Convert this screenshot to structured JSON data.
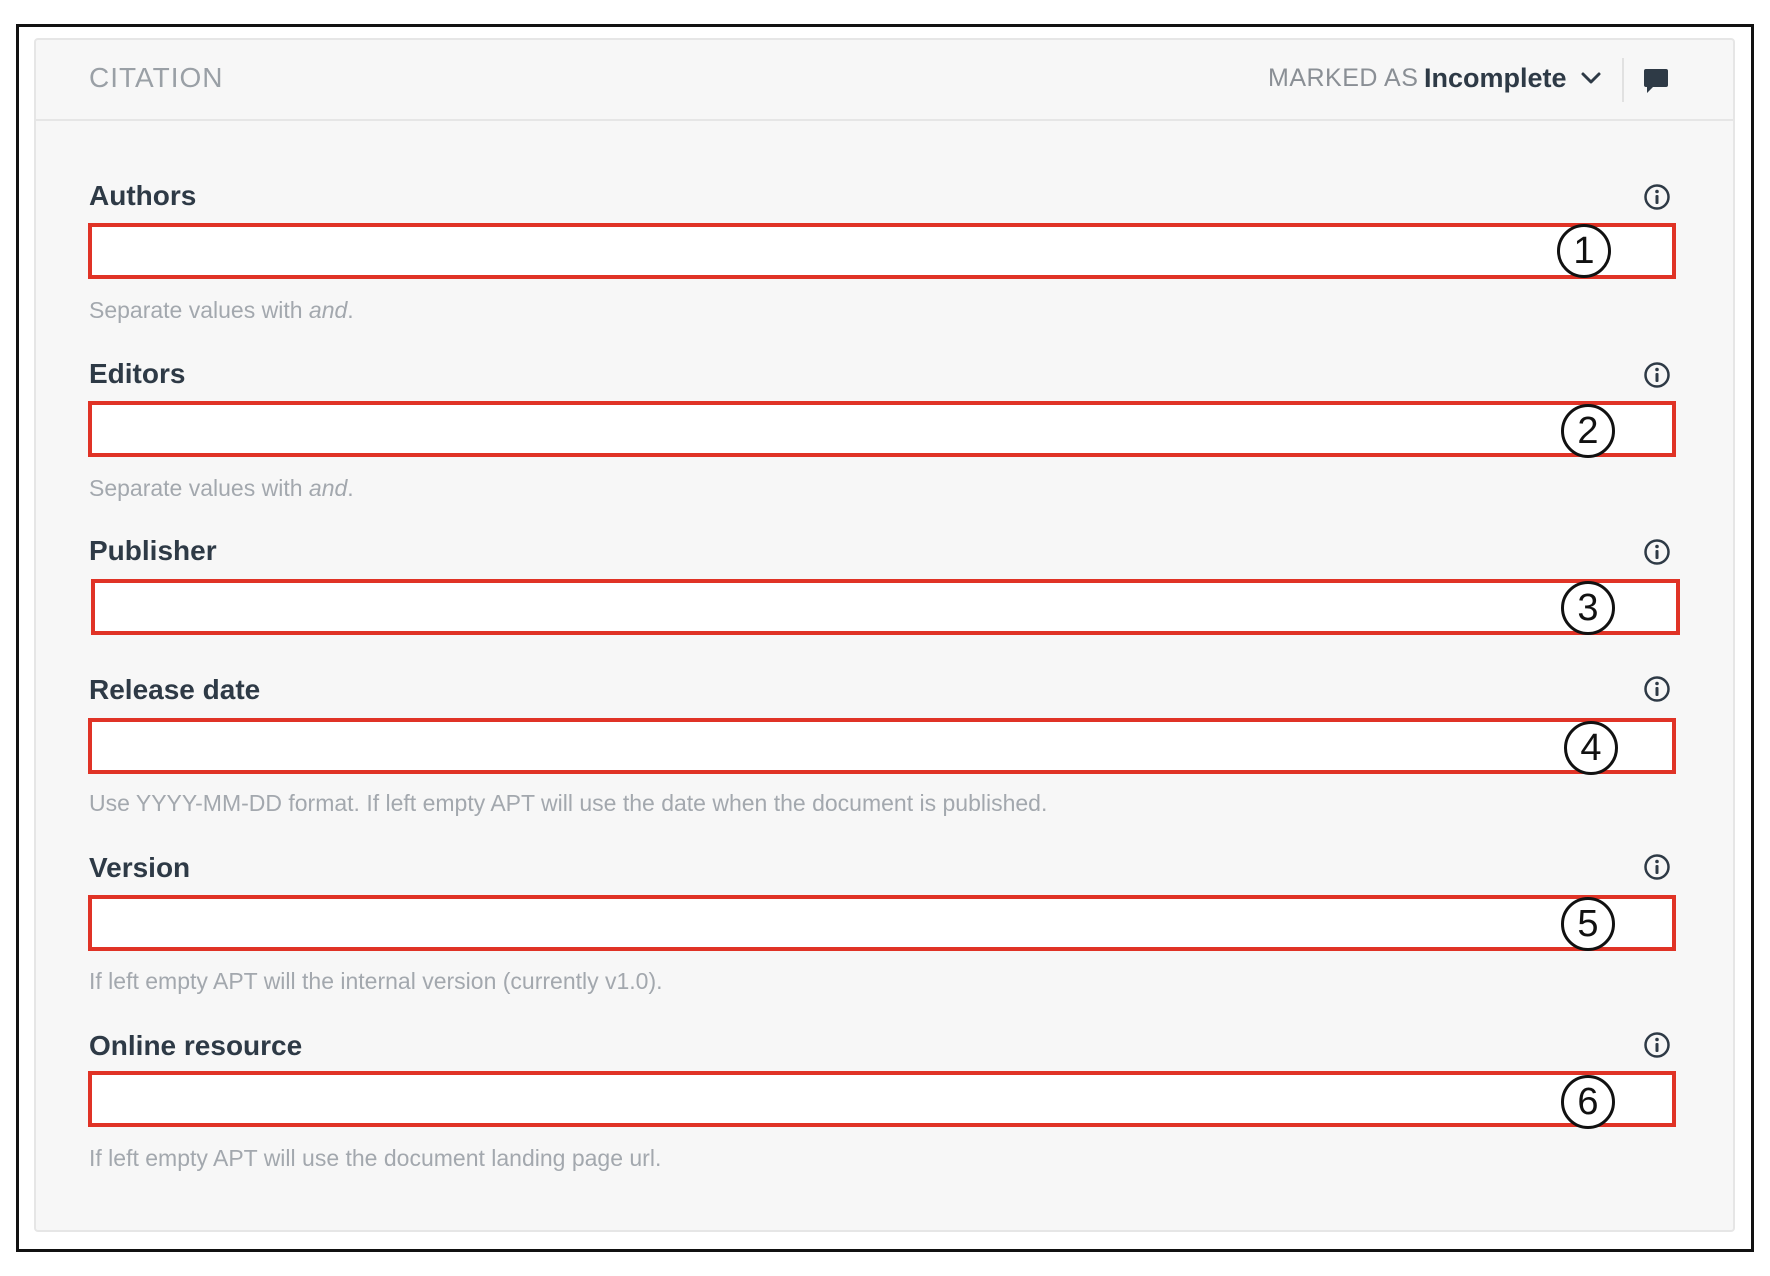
{
  "header": {
    "title": "CITATION",
    "marked_as_label": "MARKED AS",
    "status_value": "Incomplete"
  },
  "fields": [
    {
      "label": "Authors",
      "value": "",
      "marker": "1",
      "help_prefix": "Separate values with ",
      "help_em": "and",
      "help_suffix": "."
    },
    {
      "label": "Editors",
      "value": "",
      "marker": "2",
      "help_prefix": "Separate values with ",
      "help_em": "and",
      "help_suffix": "."
    },
    {
      "label": "Publisher",
      "value": "",
      "marker": "3"
    },
    {
      "label": "Release date",
      "value": "",
      "marker": "4",
      "help": "Use YYYY-MM-DD format. If left empty APT will use the date when the document is published."
    },
    {
      "label": "Version",
      "value": "",
      "marker": "5",
      "help": "If left empty APT will the internal version (currently v1.0)."
    },
    {
      "label": "Online resource",
      "value": "",
      "marker": "6",
      "help": "If left empty APT will use the document landing page url."
    }
  ],
  "colors": {
    "highlight": "#e03326",
    "label_text": "#2e3a46",
    "help_text": "#a3a8ae",
    "panel_bg": "#f7f7f7"
  },
  "icons": {
    "status": "chevron-down-icon",
    "comment": "comment-icon",
    "info": "info-icon"
  }
}
